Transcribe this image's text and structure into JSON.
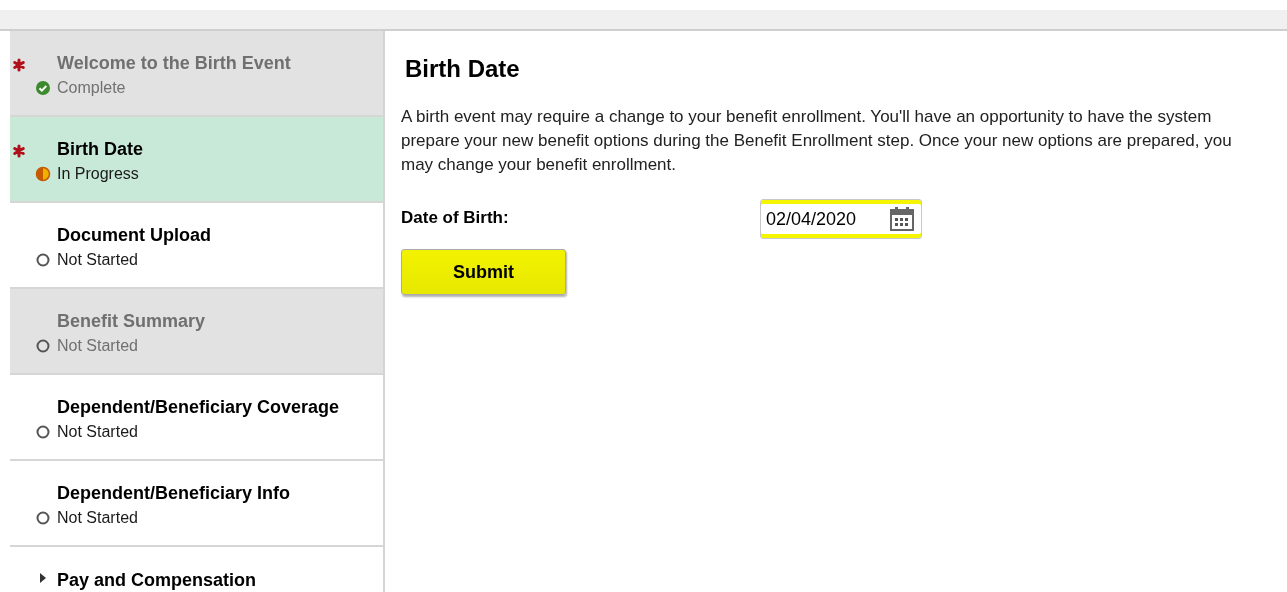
{
  "sidebar": {
    "items": [
      {
        "kind": "complete",
        "title": "Welcome to the Birth Event",
        "status": "Complete",
        "required": true,
        "disabled": true,
        "selected": false
      },
      {
        "kind": "in_progress",
        "title": "Birth Date",
        "status": "In Progress",
        "required": true,
        "disabled": false,
        "selected": true
      },
      {
        "kind": "not_started",
        "title": "Document Upload",
        "status": "Not Started",
        "required": false,
        "disabled": false,
        "selected": false
      },
      {
        "kind": "not_started",
        "title": "Benefit Summary",
        "status": "Not Started",
        "required": false,
        "disabled": true,
        "selected": false
      },
      {
        "kind": "not_started",
        "title": "Dependent/Beneficiary Coverage",
        "status": "Not Started",
        "required": false,
        "disabled": false,
        "selected": false
      },
      {
        "kind": "not_started",
        "title": "Dependent/Beneficiary Info",
        "status": "Not Started",
        "required": false,
        "disabled": false,
        "selected": false
      },
      {
        "kind": "group",
        "title": "Pay and Compensation",
        "expanded": false
      }
    ]
  },
  "content": {
    "heading": "Birth Date",
    "description": "A birth event may require a change to your benefit enrollment. You'll have an opportunity to have the system prepare your new benefit options during the Benefit Enrollment step. Once your new options are prepared, you may change your benefit enrollment.",
    "field": {
      "label": "Date of Birth:",
      "value": "02/04/2020",
      "highlighted": true
    },
    "submit": {
      "label": "Submit",
      "highlighted": true
    }
  }
}
